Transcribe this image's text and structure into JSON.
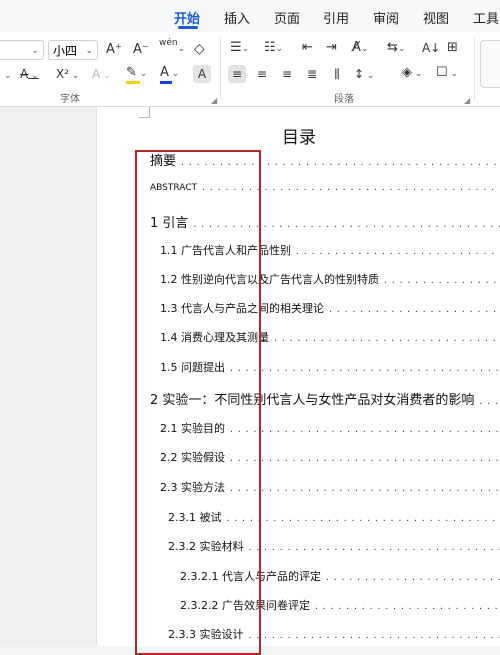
{
  "tabs": [
    "开始",
    "插入",
    "页面",
    "引用",
    "审阅",
    "视图",
    "工具"
  ],
  "ribbon": {
    "font_size": "小四",
    "font_group_label": "字体",
    "paragraph_group_label": "段落",
    "grow_font": "A⁺",
    "shrink_font": "A⁻",
    "pinyin": "wén",
    "strikethrough": "A",
    "superscript": "X²",
    "text_effect": "A",
    "font_color": "A",
    "char_shading": "A",
    "highlight": "✎",
    "line_spacing": "↕",
    "sort": "A↓",
    "colors": {
      "accent": "#1a5fd6",
      "highlight": "#f2d400",
      "font_color": "#1a3fd6"
    }
  },
  "doc": {
    "toc_title": "目录",
    "leader": "...................................................................................................................................",
    "entries": [
      {
        "text": "摘要",
        "level": 0
      },
      {
        "text": "ABSTRACT",
        "level": 0
      },
      {
        "text": "1 引言",
        "level": 0
      },
      {
        "text": "1.1 广告代言人和产品性别",
        "level": 1
      },
      {
        "text": "1.2 性别逆向代言以及广告代言人的性别特质",
        "level": 1
      },
      {
        "text": "1.3 代言人与产品之间的相关理论",
        "level": 1
      },
      {
        "text": "1.4 消费心理及其测量",
        "level": 1
      },
      {
        "text": "1.5 问题提出",
        "level": 1
      },
      {
        "text": "2 实验一：不同性别代言人与女性产品对女消费者的影响",
        "level": 0
      },
      {
        "text": "2.1 实验目的",
        "level": 1
      },
      {
        "text": "2.2 实验假设",
        "level": 1
      },
      {
        "text": "2.3 实验方法",
        "level": 1
      },
      {
        "text": "2.3.1 被试",
        "level": 2
      },
      {
        "text": "2.3.2 实验材料",
        "level": 2
      },
      {
        "text": "2.3.2.1 代言人与产品的评定",
        "level": 3
      },
      {
        "text": "2.3.2.2 广告效果问卷评定",
        "level": 3
      },
      {
        "text": "2.3.3 实验设计",
        "level": 2
      }
    ]
  }
}
